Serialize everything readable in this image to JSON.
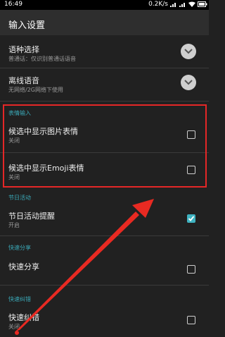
{
  "status_bar": {
    "time": "16:49",
    "network_speed": "0.2K/s"
  },
  "app_bar": {
    "title": "输入设置"
  },
  "rows": [
    {
      "title": "语种选择",
      "subtitle": "普通话：仅识别普通话语音",
      "control": "expand-circle"
    },
    {
      "title": "离线语音",
      "subtitle": "无网络/2G网络下使用",
      "control": "expand-circle"
    }
  ],
  "sections": {
    "emoji": {
      "header": "表情输入",
      "items": [
        {
          "title": "候选中显示图片表情",
          "subtitle": "关闭",
          "checked": false
        },
        {
          "title": "候选中显示Emoji表情",
          "subtitle": "关闭",
          "checked": false
        }
      ]
    },
    "festival": {
      "header": "节日活动",
      "items": [
        {
          "title": "节日活动提醒",
          "subtitle": "开启",
          "checked": true
        }
      ]
    },
    "quickshare": {
      "header": "快速分享",
      "items": [
        {
          "title": "快速分享",
          "subtitle": "",
          "checked": false
        }
      ]
    },
    "quickfix": {
      "header": "快速纠错",
      "items": [
        {
          "title": "快速纠错",
          "subtitle": "关闭",
          "checked": false
        }
      ]
    }
  },
  "colors": {
    "accent": "#3fb3c1",
    "highlight": "#e52727",
    "background": "#212121"
  }
}
